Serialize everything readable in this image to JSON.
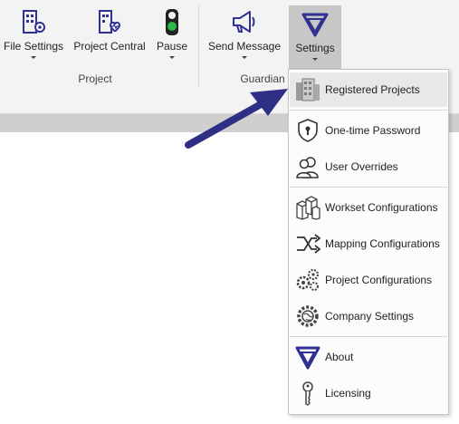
{
  "ribbon": {
    "buttons": [
      {
        "label": "File Settings",
        "icon": "file-settings-icon"
      },
      {
        "label": "Project Central",
        "icon": "project-central-icon"
      },
      {
        "label": "Pause",
        "icon": "traffic-light-icon"
      },
      {
        "label": "Send Message",
        "icon": "megaphone-icon"
      },
      {
        "label": "Settings",
        "icon": "guardian-logo-icon"
      }
    ],
    "groups": {
      "project": "Project",
      "guardian": "Guardian"
    }
  },
  "menu": {
    "items": [
      {
        "label": "Registered Projects",
        "icon": "registered-projects-icon"
      },
      {
        "label": "One-time Password",
        "icon": "shield-lock-icon"
      },
      {
        "label": "User Overrides",
        "icon": "users-icon"
      },
      {
        "label": "Workset Configurations",
        "icon": "cubes-icon"
      },
      {
        "label": "Mapping Configurations",
        "icon": "mapping-arrows-icon"
      },
      {
        "label": "Project Configurations",
        "icon": "gears-icon"
      },
      {
        "label": "Company Settings",
        "icon": "gear-globe-icon"
      },
      {
        "label": "About",
        "icon": "guardian-logo-icon"
      },
      {
        "label": "Licensing",
        "icon": "key-icon"
      }
    ]
  },
  "colors": {
    "accent": "#2f3193",
    "arrow": "#2f2f86",
    "active_button": "#c7c7c7",
    "pause_green": "#2fb84a"
  }
}
